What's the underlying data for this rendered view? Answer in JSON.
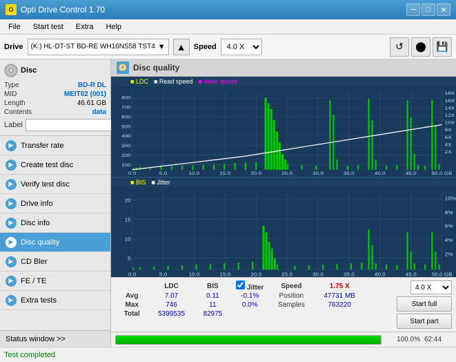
{
  "titlebar": {
    "title": "Opti Drive Control 1.70",
    "icon": "O",
    "controls": {
      "minimize": "─",
      "maximize": "□",
      "close": "✕"
    }
  },
  "menubar": {
    "items": [
      "File",
      "Start test",
      "Extra",
      "Help"
    ]
  },
  "drivebar": {
    "label": "Drive",
    "drive_name": "(K:) HL-DT-ST BD-RE WH16NS58 TST4",
    "eject_icon": "▲",
    "speed_label": "Speed",
    "speed_value": "4.0 X",
    "icon1": "↺",
    "icon2": "●",
    "icon3": "🖫"
  },
  "disc": {
    "type_label": "Type",
    "type_value": "BD-R DL",
    "mid_label": "MID",
    "mid_value": "MEIT02 (001)",
    "length_label": "Length",
    "length_value": "46.61 GB",
    "contents_label": "Contents",
    "contents_value": "data",
    "label_label": "Label",
    "label_value": ""
  },
  "nav": {
    "items": [
      {
        "id": "transfer-rate",
        "label": "Transfer rate"
      },
      {
        "id": "create-test-disc",
        "label": "Create test disc"
      },
      {
        "id": "verify-test-disc",
        "label": "Verify test disc"
      },
      {
        "id": "drive-info",
        "label": "Drive info"
      },
      {
        "id": "disc-info",
        "label": "Disc info"
      },
      {
        "id": "disc-quality",
        "label": "Disc quality",
        "active": true
      },
      {
        "id": "cd-bler",
        "label": "CD Bler"
      },
      {
        "id": "fe-te",
        "label": "FE / TE"
      },
      {
        "id": "extra-tests",
        "label": "Extra tests"
      }
    ],
    "status_window": "Status window >>"
  },
  "disc_quality": {
    "title": "Disc quality",
    "legend_top": [
      {
        "label": "LDC",
        "color": "#ffff00"
      },
      {
        "label": "Read speed",
        "color": "#ffffff"
      },
      {
        "label": "Write speed",
        "color": "#ff00ff"
      }
    ],
    "legend_bottom": [
      {
        "label": "BIS",
        "color": "#ffff00"
      },
      {
        "label": "Jitter",
        "color": "#ffffff"
      }
    ],
    "y_labels_top": [
      "800",
      "700",
      "600",
      "500",
      "400",
      "300",
      "200",
      "100"
    ],
    "y_labels_top_right": [
      "18X",
      "16X",
      "14X",
      "12X",
      "10X",
      "8X",
      "6X",
      "4X",
      "2X"
    ],
    "y_labels_bottom": [
      "20",
      "15",
      "10",
      "5"
    ],
    "y_labels_bottom_right": [
      "10%",
      "8%",
      "6%",
      "4%",
      "2%"
    ],
    "x_labels": [
      "0.0",
      "5.0",
      "10.0",
      "15.0",
      "20.0",
      "25.0",
      "30.0",
      "35.0",
      "40.0",
      "45.0",
      "50.0 GB"
    ],
    "stats": {
      "headers": [
        "LDC",
        "BIS",
        "",
        "Jitter",
        "Speed",
        "1.75 X",
        "",
        "4.0 X"
      ],
      "avg_label": "Avg",
      "avg_ldc": "7.07",
      "avg_bis": "0.11",
      "avg_jitter": "-0.1%",
      "max_label": "Max",
      "max_ldc": "746",
      "max_bis": "11",
      "max_jitter": "0.0%",
      "position_label": "Position",
      "position_value": "47731 MB",
      "total_label": "Total",
      "total_ldc": "5399535",
      "total_bis": "82975",
      "samples_label": "Samples",
      "samples_value": "763220"
    },
    "buttons": {
      "start_full": "Start full",
      "start_part": "Start part"
    }
  },
  "progress": {
    "percent": 100.0,
    "percent_text": "100.0%",
    "time": "62:44"
  },
  "statusbar": {
    "text": "Test completed"
  }
}
